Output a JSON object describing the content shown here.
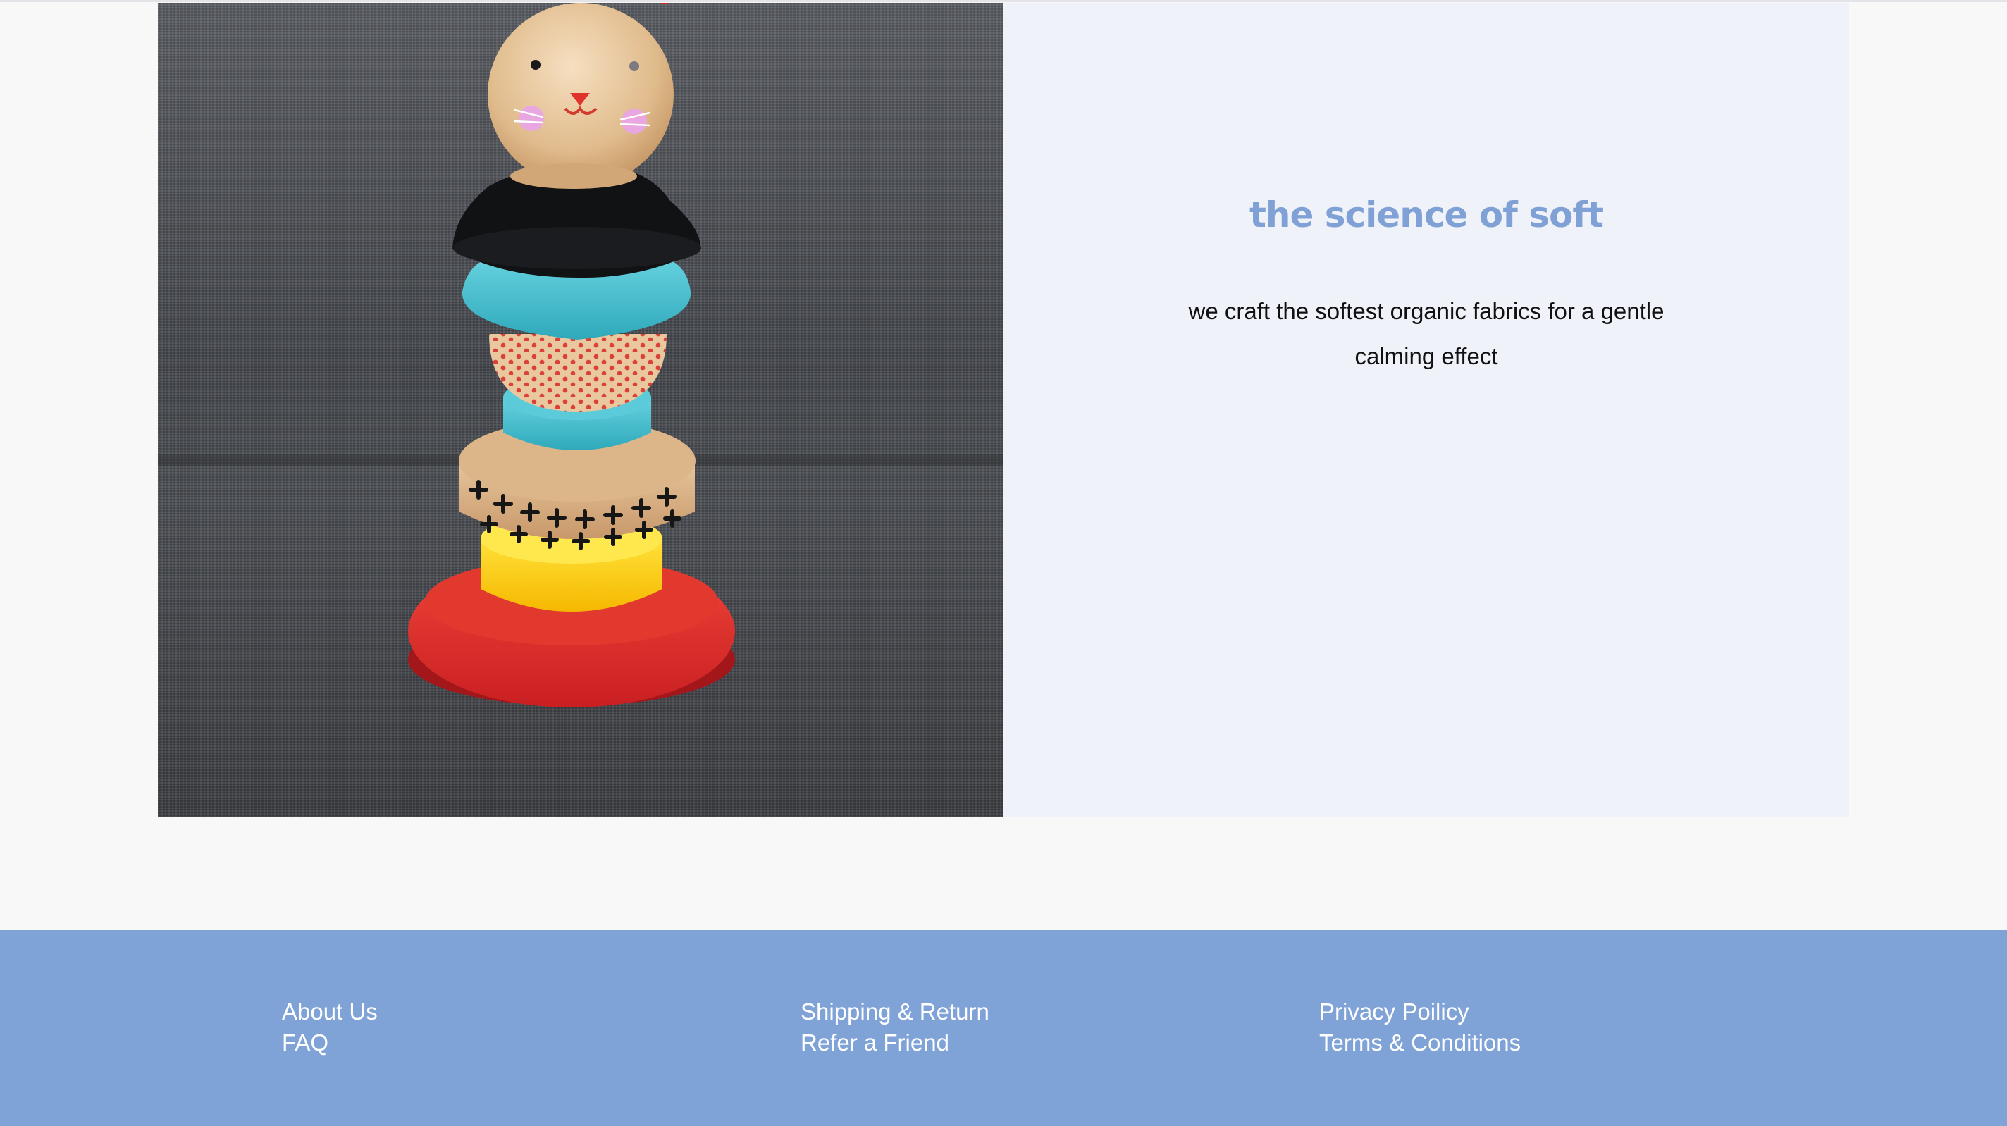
{
  "feature": {
    "image": {
      "alt": "wooden stacking toy with cat head"
    },
    "headline": "the science of soft",
    "description": "we craft the softest organic fabrics for a gentle calming effect"
  },
  "footer": {
    "columns": [
      {
        "links": [
          "About Us",
          "FAQ"
        ]
      },
      {
        "links": [
          "Shipping & Return",
          "Refer a Friend"
        ]
      },
      {
        "links": [
          "Privacy Poilicy",
          "Terms & Conditions"
        ]
      }
    ]
  },
  "colors": {
    "accent": "#7fa1d6",
    "footer_bg": "#7fa2d7",
    "panel_bg": "#f0f2f9",
    "page_bg": "#f8f8f8"
  }
}
